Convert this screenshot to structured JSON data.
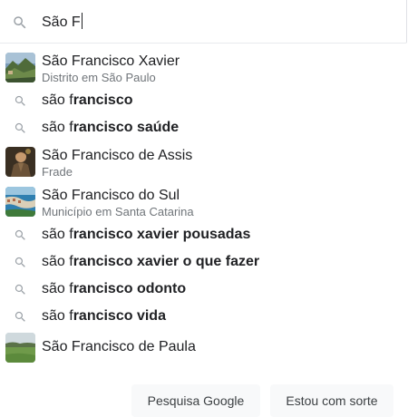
{
  "search": {
    "value": "São F"
  },
  "suggestions": [
    {
      "type": "entity",
      "title": "São Francisco Xavier",
      "subtitle": "Distrito em São Paulo",
      "thumb": "mountain-landscape"
    },
    {
      "type": "query",
      "prefix": "são f",
      "rest": "rancisco",
      "icon": "search-icon"
    },
    {
      "type": "query",
      "prefix": "são f",
      "rest": "rancisco saúde",
      "icon": "search-icon"
    },
    {
      "type": "entity",
      "title": "São Francisco de Assis",
      "subtitle": "Frade",
      "thumb": "saint-painting"
    },
    {
      "type": "entity",
      "title": "São Francisco do Sul",
      "subtitle": "Município em Santa Catarina",
      "thumb": "coastal-city"
    },
    {
      "type": "query",
      "prefix": "são f",
      "rest": "rancisco xavier pousadas",
      "icon": "search-icon"
    },
    {
      "type": "query",
      "prefix": "são f",
      "rest": "rancisco xavier o que fazer",
      "icon": "search-icon"
    },
    {
      "type": "query",
      "prefix": "são f",
      "rest": "rancisco odonto",
      "icon": "search-icon"
    },
    {
      "type": "query",
      "prefix": "são f",
      "rest": "rancisco vida",
      "icon": "search-icon"
    },
    {
      "type": "entity",
      "title": "São Francisco de Paula",
      "subtitle": "",
      "thumb": "green-field"
    }
  ],
  "buttons": {
    "google_search": "Pesquisa Google",
    "lucky": "Estou com sorte"
  },
  "colors": {
    "text": "#202124",
    "subtext": "#70757a",
    "icon": "#9aa0a6",
    "button_bg": "#f8f9fa"
  }
}
